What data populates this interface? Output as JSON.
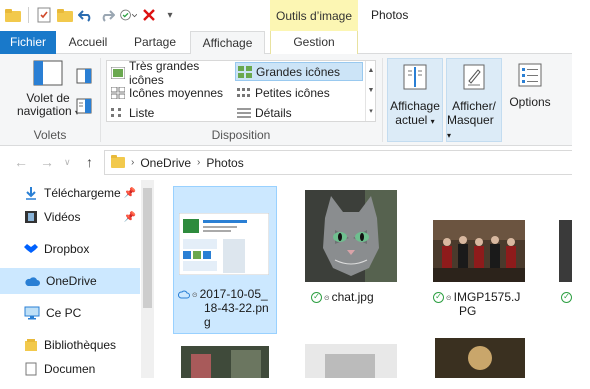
{
  "titlebar": {
    "context_tab_label": "Outils d’image",
    "window_title": "Photos"
  },
  "tabs": {
    "fichier": "Fichier",
    "accueil": "Accueil",
    "partage": "Partage",
    "affichage": "Affichage",
    "gestion": "Gestion"
  },
  "ribbon": {
    "volet_nav_label_1": "Volet de",
    "volet_nav_label_2": "navigation",
    "volet_nav_caret": "▾",
    "volets_group": "Volets",
    "layout": {
      "tres_grandes": "Très grandes icônes",
      "grandes": "Grandes icônes",
      "moyennes": "Icônes moyennes",
      "petites": "Petites icônes",
      "liste": "Liste",
      "details": "Détails"
    },
    "disposition_group": "Disposition",
    "affichage_actuel_1": "Affichage",
    "affichage_actuel_2": "actuel",
    "afficher_masquer_1": "Afficher/",
    "afficher_masquer_2": "Masquer",
    "options": "Options",
    "caret": "▾"
  },
  "address": {
    "path_segments": [
      "OneDrive",
      "Photos"
    ],
    "sep": "›"
  },
  "nav": {
    "items": [
      {
        "label": "Téléchargeme",
        "pinned": true
      },
      {
        "label": "Vidéos",
        "pinned": true
      },
      {
        "label": "Dropbox",
        "pinned": false
      },
      {
        "label": "OneDrive",
        "pinned": false
      },
      {
        "label": "Ce PC",
        "pinned": false
      },
      {
        "label": "Bibliothèques",
        "pinned": false
      },
      {
        "label": "Documen",
        "pinned": false
      }
    ]
  },
  "files": [
    {
      "name_l1": "2017-10-05_",
      "name_l2": "18-43-22.pn",
      "name_l3": "g",
      "status": "cloud",
      "selected": true
    },
    {
      "name_l1": "chat.jpg",
      "status": "ok",
      "selected": false
    },
    {
      "name_l1": "IMGP1575.J",
      "name_l2": "PG",
      "status": "ok",
      "selected": false
    }
  ],
  "colors": {
    "fichier_tab": "#1979ca",
    "context_tab": "#fcf6b3",
    "selection": "#cce8ff",
    "sync_ok": "#2ea043"
  }
}
